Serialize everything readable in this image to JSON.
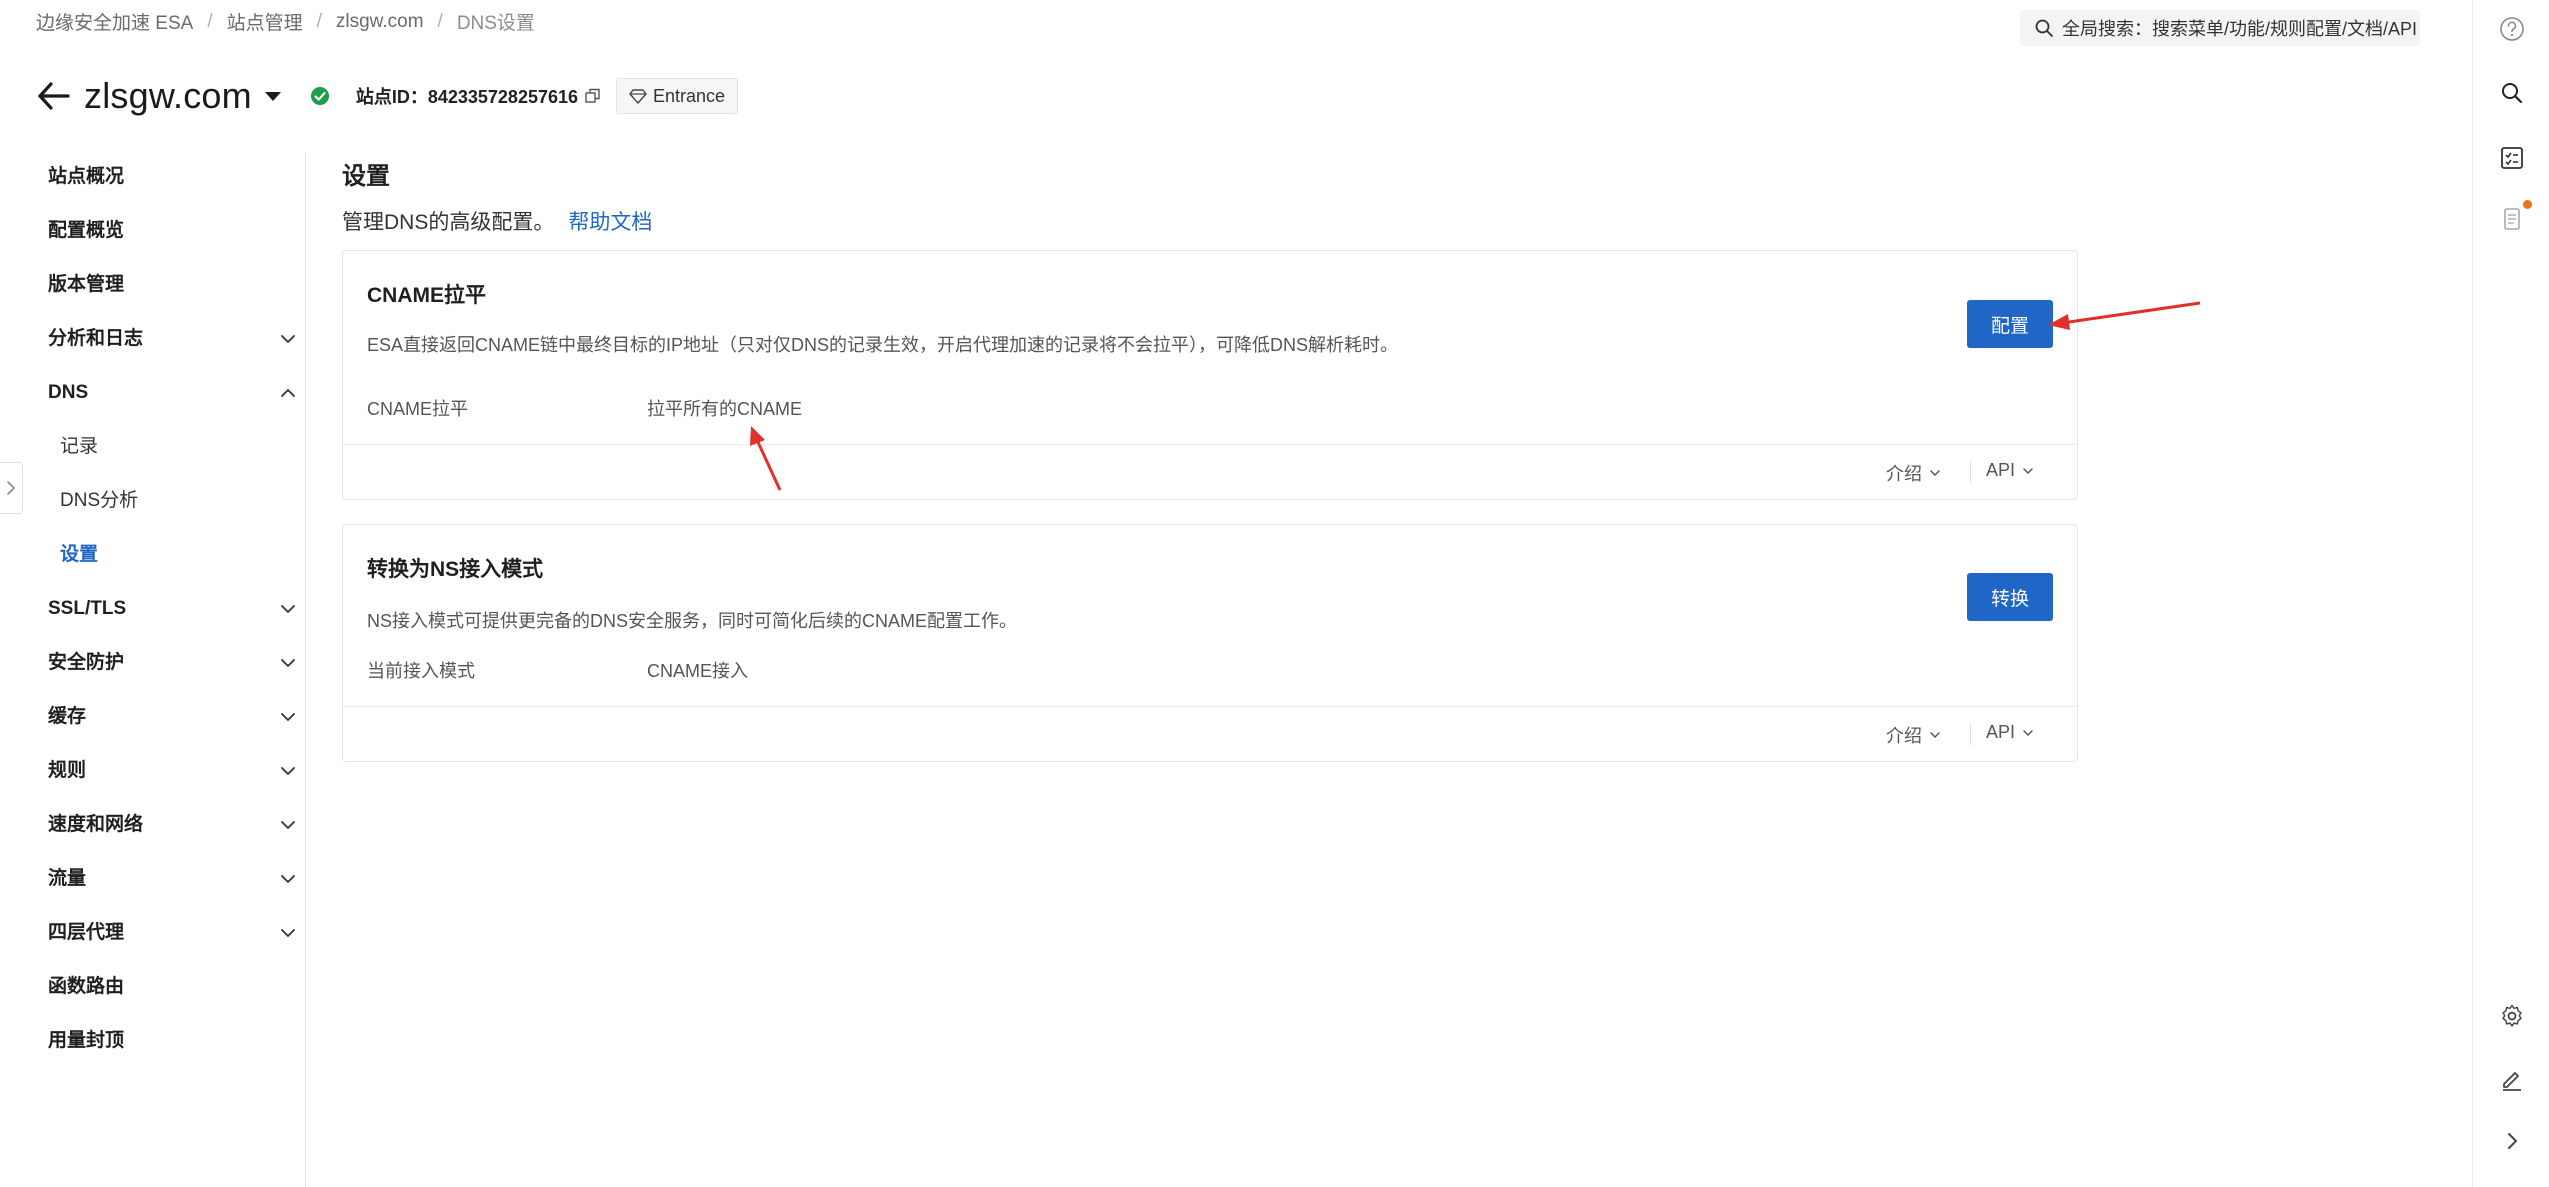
{
  "breadcrumb": [
    "边缘安全加速 ESA",
    "站点管理",
    "zlsgw.com",
    "DNS设置"
  ],
  "global_search": {
    "label": "全局搜索：搜索菜单/功能/规则配置/文档/API"
  },
  "site": {
    "name": "zlsgw.com",
    "id_label": "站点ID：",
    "id_value": "842335728257616",
    "badge": "Entrance",
    "status_color": "#1e9e4a"
  },
  "sidebar": {
    "items": [
      {
        "label": "站点概况"
      },
      {
        "label": "配置概览"
      },
      {
        "label": "版本管理"
      },
      {
        "label": "分析和日志"
      },
      {
        "label": "DNS"
      },
      {
        "label": "记录"
      },
      {
        "label": "DNS分析"
      },
      {
        "label": "设置"
      },
      {
        "label": "SSL/TLS"
      },
      {
        "label": "安全防护"
      },
      {
        "label": "缓存"
      },
      {
        "label": "规则"
      },
      {
        "label": "速度和网络"
      },
      {
        "label": "流量"
      },
      {
        "label": "四层代理"
      },
      {
        "label": "函数路由"
      },
      {
        "label": "用量封顶"
      }
    ]
  },
  "page": {
    "title": "设置",
    "subtitle": "管理DNS的高级配置。",
    "help_link": "帮助文档"
  },
  "cards": [
    {
      "title": "CNAME拉平",
      "description": "ESA直接返回CNAME链中最终目标的IP地址（只对仅DNS的记录生效，开启代理加速的记录将不会拉平），可降低DNS解析耗时。",
      "row_label": "CNAME拉平",
      "row_value": "拉平所有的CNAME",
      "button": "配置",
      "footer_intro": "介绍",
      "footer_api": "API"
    },
    {
      "title": "转换为NS接入模式",
      "description": "NS接入模式可提供更完备的DNS安全服务，同时可简化后续的CNAME配置工作。",
      "row_label": "当前接入模式",
      "row_value": "CNAME接入",
      "button": "转换",
      "footer_intro": "介绍",
      "footer_api": "API"
    }
  ],
  "colors": {
    "accent": "#1f66c7",
    "annotation_arrow": "#e0302a",
    "notification_dot": "#f0701e"
  },
  "right_rail_icons": [
    "help-icon",
    "search-icon",
    "checklist-icon",
    "notes-icon",
    "settings-icon",
    "edit-icon",
    "expand-icon"
  ]
}
